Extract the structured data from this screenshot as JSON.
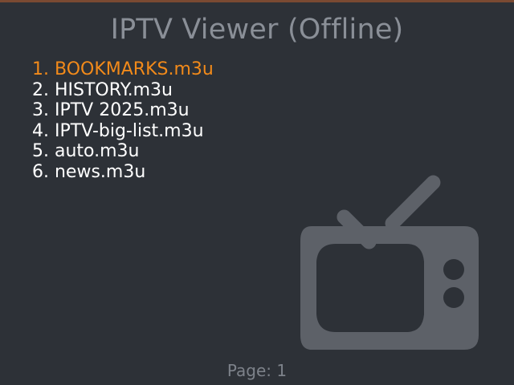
{
  "app": {
    "title": "IPTV Viewer (Offline)"
  },
  "playlists": [
    {
      "label": "1. BOOKMARKS.m3u",
      "selected": true
    },
    {
      "label": "2. HISTORY.m3u",
      "selected": false
    },
    {
      "label": "3. IPTV 2025.m3u",
      "selected": false
    },
    {
      "label": "4. IPTV-big-list.m3u",
      "selected": false
    },
    {
      "label": "5. auto.m3u",
      "selected": false
    },
    {
      "label": "6. news.m3u",
      "selected": false
    }
  ],
  "footer": {
    "page_label": "Page: 1"
  },
  "icons": {
    "decoration": "tv-icon"
  },
  "colors": {
    "background": "#2d3137",
    "selected_item": "#f28a1a",
    "item": "#ffffff",
    "title": "#8a8f97",
    "tv_icon": "#5d6168"
  }
}
